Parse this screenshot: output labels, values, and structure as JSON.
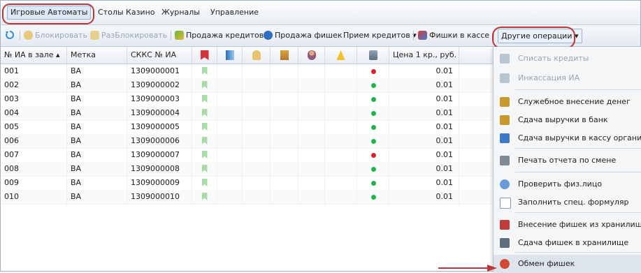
{
  "menubar": {
    "items": [
      "Игровые Автоматы",
      "Столы Казино",
      "Журналы",
      "Управление"
    ]
  },
  "toolbar": {
    "block": "Блокировать",
    "unblock": "РазБлокировать",
    "sell_credits": "Продажа кредитов",
    "sell_chips": "Продажа фишек",
    "receive_credits": "Прием кредитов ▾",
    "chips_in_cash": "Фишки в кассе",
    "other_ops": "Другие операции ▾"
  },
  "grid": {
    "headers": {
      "num": "№ ИА в зале ▴",
      "tag": "Метка",
      "skks": "СККС № ИА",
      "price": "Цена 1 кр., руб."
    },
    "rows": [
      {
        "num": "001",
        "tag": "BA",
        "skks": "1309000001",
        "status": "red",
        "price": "0.01"
      },
      {
        "num": "002",
        "tag": "BA",
        "skks": "1309000002",
        "status": "green",
        "price": "0.01"
      },
      {
        "num": "003",
        "tag": "BA",
        "skks": "1309000003",
        "status": "green",
        "price": "0.01"
      },
      {
        "num": "004",
        "tag": "BA",
        "skks": "1309000004",
        "status": "green",
        "price": "0.01"
      },
      {
        "num": "005",
        "tag": "BA",
        "skks": "1309000005",
        "status": "green",
        "price": "0.01"
      },
      {
        "num": "006",
        "tag": "BA",
        "skks": "1309000006",
        "status": "green",
        "price": "0.01"
      },
      {
        "num": "007",
        "tag": "BA",
        "skks": "1309000007",
        "status": "red",
        "price": "0.01"
      },
      {
        "num": "008",
        "tag": "BA",
        "skks": "1309000008",
        "status": "green",
        "price": "0.01"
      },
      {
        "num": "009",
        "tag": "BA",
        "skks": "1309000009",
        "status": "green",
        "price": "0.01"
      },
      {
        "num": "010",
        "tag": "BA",
        "skks": "1309000010",
        "status": "green",
        "price": "0.01"
      }
    ]
  },
  "dropdown": {
    "items": [
      {
        "label": "Списать кредиты",
        "icon": "write-off-icon",
        "disabled": true
      },
      {
        "label": "Инкассация ИА",
        "icon": "collection-icon",
        "disabled": true
      },
      {
        "label": "Служебное внесение денег",
        "icon": "bank-icon",
        "disabled": false
      },
      {
        "label": "Сдача выручки в банк",
        "icon": "bank-icon",
        "disabled": false
      },
      {
        "label": "Сдача выручки в кассу организации",
        "icon": "cashbox-icon",
        "disabled": false
      },
      {
        "label": "Печать отчета по смене",
        "icon": "printer-icon",
        "disabled": false
      },
      {
        "label": "Проверить физ.лицо",
        "icon": "users-icon",
        "disabled": false
      },
      {
        "label": "Заполнить спец. формуляр",
        "icon": "form-icon",
        "disabled": false
      },
      {
        "label": "Внесение фишек из хранилища",
        "icon": "chips-in-icon",
        "disabled": false
      },
      {
        "label": "Сдача фишек в хранилище",
        "icon": "chips-out-icon",
        "disabled": false
      },
      {
        "label": "Обмен фишек",
        "icon": "chips-exchange-icon",
        "disabled": false,
        "highlighted": true
      }
    ]
  },
  "colors": {
    "callout": "#c0353b",
    "status_green": "#22b14c",
    "status_red": "#d8202a",
    "bookmark": "#a9dba8"
  }
}
